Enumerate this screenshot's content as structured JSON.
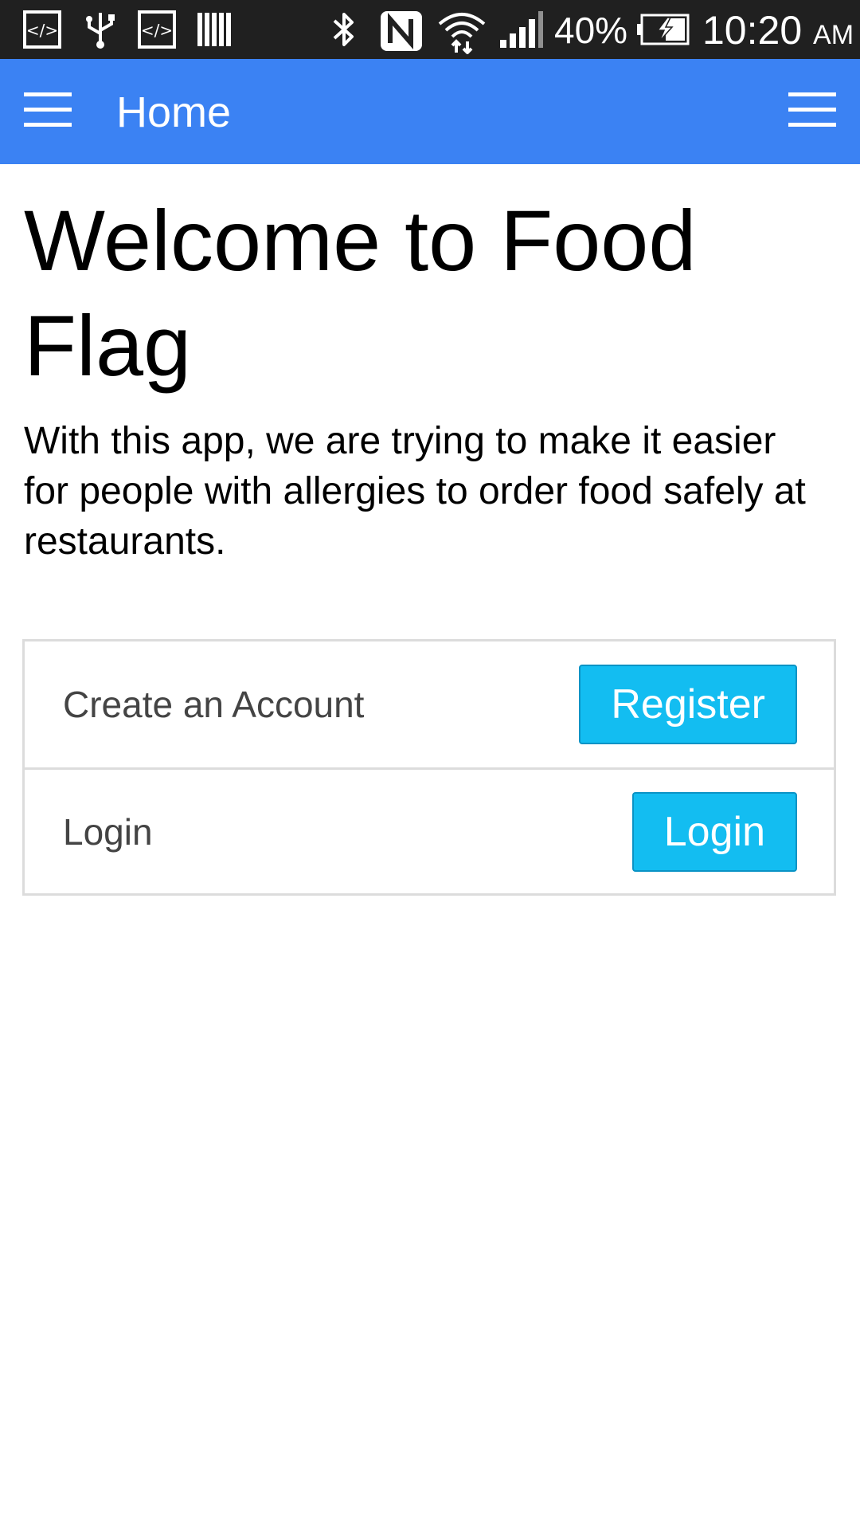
{
  "status_bar": {
    "battery_percent": "40%",
    "time": "10:20",
    "ampm": "AM",
    "icons": [
      "code-icon",
      "usb-icon",
      "code-icon",
      "barcode-icon",
      "bluetooth-icon",
      "nfc-icon",
      "wifi-icon",
      "signal-icon",
      "battery-charging-icon"
    ]
  },
  "app_bar": {
    "title": "Home",
    "left_icon": "menu-icon",
    "right_icon": "menu-icon",
    "color": "#3b82f3"
  },
  "content": {
    "heading": "Welcome to Food Flag",
    "intro": "With this app, we are trying to make it easier for people with allergies to order food safely at restaurants."
  },
  "actions": {
    "register": {
      "label": "Create an Account",
      "button": "Register"
    },
    "login": {
      "label": "Login",
      "button": "Login"
    },
    "button_color": "#13bdf1"
  }
}
